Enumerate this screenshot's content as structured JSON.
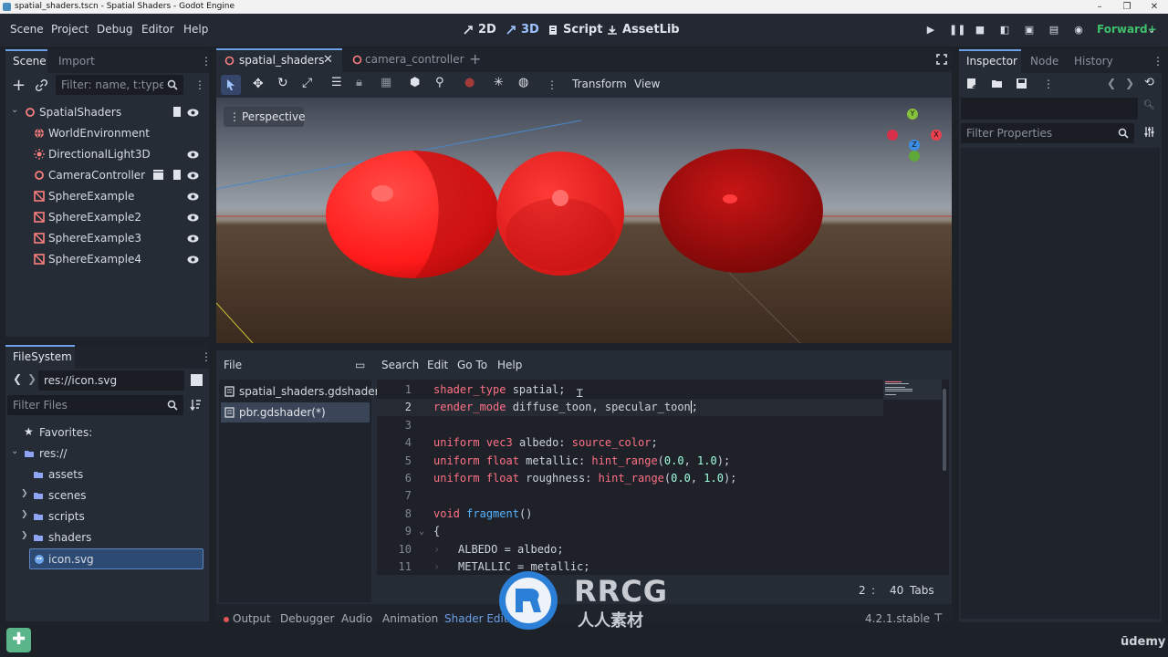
{
  "window": {
    "title": "spatial_shaders.tscn - Spatial Shaders - Godot Engine",
    "minimize": "–",
    "maximize": "❐",
    "close": "✕"
  },
  "menu": {
    "items": [
      "Scene",
      "Project",
      "Debug",
      "Editor",
      "Help"
    ],
    "workspaces": [
      "2D",
      "3D",
      "Script",
      "AssetLib"
    ],
    "active_workspace": "3D",
    "renderer": "Forward+"
  },
  "scene_dock": {
    "tabs": [
      "Scene",
      "Import"
    ],
    "filter_placeholder": "Filter: name, t:type, g",
    "nodes": [
      {
        "name": "SpatialShaders",
        "icon": "node3d-icon",
        "color": "#fc7f7f"
      },
      {
        "name": "WorldEnvironment",
        "icon": "world-environment-icon",
        "color": "#fc7f7f"
      },
      {
        "name": "DirectionalLight3D",
        "icon": "directional-light-icon",
        "color": "#fc7f7f"
      },
      {
        "name": "CameraController",
        "icon": "node3d-icon",
        "color": "#fc7f7f"
      },
      {
        "name": "SphereExample",
        "icon": "mesh-instance-icon",
        "color": "#fc7f7f"
      },
      {
        "name": "SphereExample2",
        "icon": "mesh-instance-icon",
        "color": "#fc7f7f"
      },
      {
        "name": "SphereExample3",
        "icon": "mesh-instance-icon",
        "color": "#fc7f7f"
      },
      {
        "name": "SphereExample4",
        "icon": "mesh-instance-icon",
        "color": "#fc7f7f"
      }
    ]
  },
  "filesystem_dock": {
    "tab": "FileSystem",
    "path": "res://icon.svg",
    "filter_placeholder": "Filter Files",
    "favorites_label": "Favorites:",
    "root_label": "res://",
    "folders": [
      "assets",
      "scenes",
      "scripts",
      "shaders"
    ],
    "selected_file": "icon.svg"
  },
  "editor_tabs": {
    "tabs": [
      "spatial_shaders",
      "camera_controller"
    ],
    "active": "spatial_shaders",
    "close": "✕",
    "add": "+"
  },
  "viewport_toolbar": {
    "transform_label": "Transform",
    "view_label": "View",
    "perspective_label": "Perspective",
    "gizmo_axes": {
      "x": "X",
      "y": "Y",
      "z": "Z"
    }
  },
  "shader_editor": {
    "menu": [
      "File",
      "Search",
      "Edit",
      "Go To",
      "Help"
    ],
    "files": [
      "spatial_shaders.gdshader",
      "pbr.gdshader(*)"
    ],
    "active_file": "pbr.gdshader(*)",
    "lines": [
      {
        "n": "1",
        "text": "shader_type spatial;"
      },
      {
        "n": "2",
        "text": "render_mode diffuse_toon, specular_toon;"
      },
      {
        "n": "3",
        "text": ""
      },
      {
        "n": "4",
        "text": "uniform vec3 albedo: source_color;"
      },
      {
        "n": "5",
        "text": "uniform float metallic: hint_range(0.0, 1.0);"
      },
      {
        "n": "6",
        "text": "uniform float roughness: hint_range(0.0, 1.0);"
      },
      {
        "n": "7",
        "text": ""
      },
      {
        "n": "8",
        "text": "void fragment()"
      },
      {
        "n": "9",
        "text": "{"
      },
      {
        "n": "10",
        "text": "ALBEDO = albedo;"
      },
      {
        "n": "11",
        "text": "METALLIC = metallic;"
      }
    ],
    "cursor": {
      "line": "2",
      "separator": ":",
      "col": "40"
    },
    "indent": "Tabs"
  },
  "bottom_panel": {
    "tabs": [
      "Output",
      "Debugger",
      "Audio",
      "Animation",
      "Shader Editor"
    ],
    "active": "Shader Editor",
    "version": "4.2.1.stable"
  },
  "inspector": {
    "tabs": [
      "Inspector",
      "Node",
      "History"
    ],
    "filter_placeholder": "Filter Properties"
  },
  "watermark": {
    "brand": "RRCG",
    "sub": "人人素材",
    "udemy": "ūdemy"
  },
  "colors": {
    "accent": "#6b9fe6",
    "node_red": "#fc7f7f",
    "folder": "#8da5f3",
    "renderer": "#3fbf6a"
  }
}
